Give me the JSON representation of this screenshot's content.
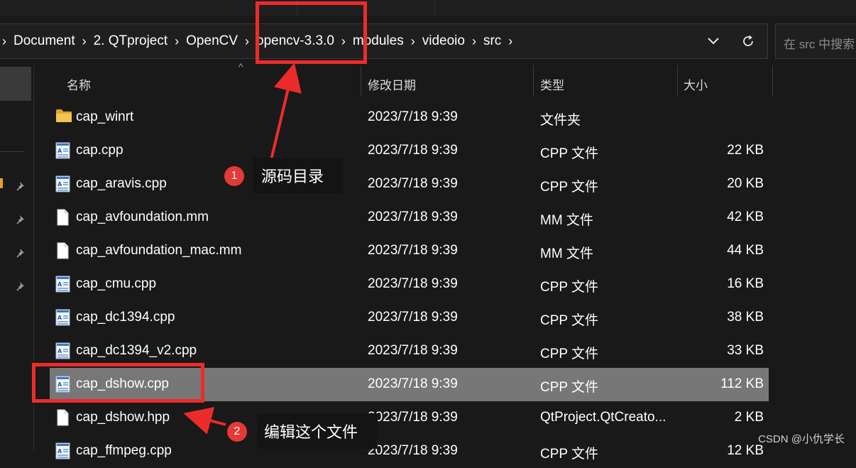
{
  "breadcrumb": [
    "Document",
    "2. QTproject",
    "OpenCV",
    "opencv-3.3.0",
    "modules",
    "videoio",
    "src"
  ],
  "address_buttons": {
    "dropdown_icon": "chevron-down-icon",
    "refresh_icon": "refresh-icon"
  },
  "search": {
    "placeholder": "在 src 中搜索"
  },
  "columns": {
    "name": "名称",
    "date": "修改日期",
    "type": "类型",
    "size": "大小"
  },
  "files": [
    {
      "name": "cap_winrt",
      "date": "2023/7/18 9:39",
      "type": "文件夹",
      "size": "",
      "icon": "folder-icon"
    },
    {
      "name": "cap.cpp",
      "date": "2023/7/18 9:39",
      "type": "CPP 文件",
      "size": "22 KB",
      "icon": "cpp-file-icon"
    },
    {
      "name": "cap_aravis.cpp",
      "date": "2023/7/18 9:39",
      "type": "CPP 文件",
      "size": "20 KB",
      "icon": "cpp-file-icon"
    },
    {
      "name": "cap_avfoundation.mm",
      "date": "2023/7/18 9:39",
      "type": "MM 文件",
      "size": "42 KB",
      "icon": "file-icon"
    },
    {
      "name": "cap_avfoundation_mac.mm",
      "date": "2023/7/18 9:39",
      "type": "MM 文件",
      "size": "44 KB",
      "icon": "file-icon"
    },
    {
      "name": "cap_cmu.cpp",
      "date": "2023/7/18 9:39",
      "type": "CPP 文件",
      "size": "16 KB",
      "icon": "cpp-file-icon"
    },
    {
      "name": "cap_dc1394.cpp",
      "date": "2023/7/18 9:39",
      "type": "CPP 文件",
      "size": "38 KB",
      "icon": "cpp-file-icon"
    },
    {
      "name": "cap_dc1394_v2.cpp",
      "date": "2023/7/18 9:39",
      "type": "CPP 文件",
      "size": "33 KB",
      "icon": "cpp-file-icon"
    },
    {
      "name": "cap_dshow.cpp",
      "date": "2023/7/18 9:39",
      "type": "CPP 文件",
      "size": "112 KB",
      "icon": "cpp-file-icon",
      "selected": true
    },
    {
      "name": "cap_dshow.hpp",
      "date": "2023/7/18 9:39",
      "type": "QtProject.QtCreato...",
      "size": "2 KB",
      "icon": "file-icon"
    },
    {
      "name": "cap_ffmpeg.cpp",
      "date": "2023/7/18 9:39",
      "type": "CPP 文件",
      "size": "12 KB",
      "icon": "cpp-file-icon"
    }
  ],
  "annotations": [
    {
      "number": "1",
      "text": "源码目录"
    },
    {
      "number": "2",
      "text": "编辑这个文件"
    }
  ],
  "watermark": "CSDN @小仇学长",
  "colors": {
    "highlight": "#ee2b2b",
    "badge": "#e53935",
    "selected_row": "#777777",
    "folder": "#e3a22a"
  }
}
